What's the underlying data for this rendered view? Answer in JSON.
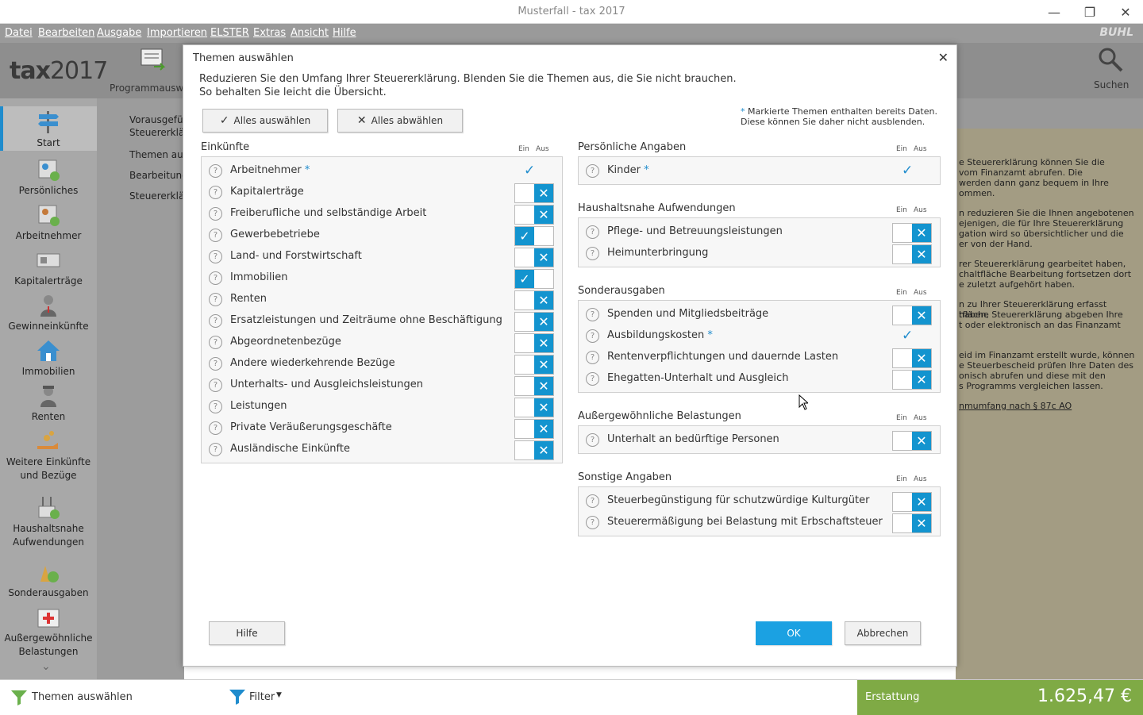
{
  "window": {
    "title": "Musterfall - tax 2017",
    "minimize": "—",
    "restore": "❐",
    "close": "✕"
  },
  "menu": {
    "items": [
      "Datei",
      "Bearbeiten",
      "Ausgabe",
      "Importieren",
      "ELSTER",
      "Extras",
      "Ansicht",
      "Hilfe"
    ],
    "brand": "BUHL"
  },
  "ribbon": {
    "logo_tax": "tax",
    "logo_year": "2017",
    "program_button": "Programmausw",
    "search_button": "Suchen"
  },
  "sidebar": {
    "items": [
      {
        "label": "Start",
        "icon": "signpost-icon"
      },
      {
        "label": "Persönliches",
        "icon": "person-card-icon"
      },
      {
        "label": "Arbeitnehmer",
        "icon": "worker-icon"
      },
      {
        "label": "Kapitalerträge",
        "icon": "money-icon"
      },
      {
        "label": "Gewinneinkünfte",
        "icon": "businessman-icon"
      },
      {
        "label": "Immobilien",
        "icon": "house-icon"
      },
      {
        "label": "Renten",
        "icon": "pensioner-icon"
      },
      {
        "label": "Weitere Einkünfte und Bezüge",
        "icon": "coins-hand-icon"
      },
      {
        "label": "Haushaltsnahe Aufwendungen",
        "icon": "household-icon"
      },
      {
        "label": "Sonderausgaben",
        "icon": "special-expenses-icon"
      },
      {
        "label": "Außergewöhnliche Belastungen",
        "icon": "first-aid-icon"
      }
    ]
  },
  "left_panel": {
    "items": [
      "Vorausgefü",
      "Steuererklä",
      "Themen aus",
      "Bearbeitung",
      "Steuererklä"
    ]
  },
  "right_panel": {
    "lines": [
      "e Steuererklärung können Sie die",
      "vom Finanzamt abrufen. Die",
      "werden dann ganz bequem in Ihre",
      "ommen.",
      "n reduzieren Sie die Ihnen angebotenen",
      "ejenigen, die für Ihre Steuererklärung",
      "gation wird so übersichtlicher und die",
      "er von der Hand.",
      "rer Steuererklärung gearbeitet haben,",
      "chaltfläche Bearbeitung fortsetzen dort",
      "e zuletzt aufgehört haben.",
      "n zu Ihrer Steuererklärung erfasst haben,",
      "tfläche Steuererklärung abgeben Ihre",
      "t oder elektronisch an das Finanzamt",
      "eid im Finanzamt erstellt wurde, können",
      "e Steuerbescheid prüfen Ihre Daten des",
      "onisch abrufen und diese mit den",
      "s Programms vergleichen lassen.",
      "nmumfang nach § 87c AO"
    ]
  },
  "bottom": {
    "themen": "Themen auswählen",
    "filter": "Filter",
    "erstattung_label": "Erstattung",
    "erstattung_value": "1.625,47 €"
  },
  "dialog": {
    "title": "Themen auswählen",
    "close": "✕",
    "intro1": "Reduzieren Sie den Umfang Ihrer Steuererklärung. Blenden Sie die Themen aus, die Sie nicht brauchen.",
    "intro2": "So behalten Sie leicht die Übersicht.",
    "note_star": "*",
    "note1": " Markierte Themen enthalten bereits Daten.",
    "note2": "Diese können Sie daher nicht ausblenden.",
    "select_all": "Alles auswählen",
    "deselect_all": "Alles abwählen",
    "ein": "Ein",
    "aus": "Aus",
    "help_button": "Hilfe",
    "ok_button": "OK",
    "cancel_button": "Abbrechen",
    "sections_left": [
      {
        "title": "Einkünfte",
        "rows": [
          {
            "label": "Arbeitnehmer",
            "star": true,
            "state": "locked"
          },
          {
            "label": "Kapitalerträge",
            "state": "aus"
          },
          {
            "label": "Freiberufliche und selbständige Arbeit",
            "state": "aus"
          },
          {
            "label": "Gewerbebetriebe",
            "state": "ein"
          },
          {
            "label": "Land- und Forstwirtschaft",
            "state": "aus"
          },
          {
            "label": "Immobilien",
            "state": "ein"
          },
          {
            "label": "Renten",
            "state": "aus"
          },
          {
            "label": "Ersatzleistungen und Zeiträume ohne Beschäftigung",
            "state": "aus"
          },
          {
            "label": "Abgeordnetenbezüge",
            "state": "aus"
          },
          {
            "label": "Andere wiederkehrende Bezüge",
            "state": "aus"
          },
          {
            "label": "Unterhalts- und Ausgleichsleistungen",
            "state": "aus"
          },
          {
            "label": "Leistungen",
            "state": "aus"
          },
          {
            "label": "Private Veräußerungsgeschäfte",
            "state": "aus"
          },
          {
            "label": "Ausländische Einkünfte",
            "state": "aus"
          }
        ]
      }
    ],
    "sections_right": [
      {
        "title": "Persönliche Angaben",
        "rows": [
          {
            "label": "Kinder",
            "star": true,
            "state": "locked"
          }
        ]
      },
      {
        "title": "Haushaltsnahe Aufwendungen",
        "rows": [
          {
            "label": "Pflege- und Betreuungsleistungen",
            "state": "aus"
          },
          {
            "label": "Heimunterbringung",
            "state": "aus"
          }
        ]
      },
      {
        "title": "Sonderausgaben",
        "rows": [
          {
            "label": "Spenden und Mitgliedsbeiträge",
            "state": "aus"
          },
          {
            "label": "Ausbildungskosten",
            "star": true,
            "state": "locked"
          },
          {
            "label": "Rentenverpflichtungen und dauernde Lasten",
            "state": "aus"
          },
          {
            "label": "Ehegatten-Unterhalt und Ausgleich",
            "state": "aus"
          }
        ]
      },
      {
        "title": "Außergewöhnliche Belastungen",
        "rows": [
          {
            "label": "Unterhalt an bedürftige Personen",
            "state": "aus"
          }
        ]
      },
      {
        "title": "Sonstige Angaben",
        "rows": [
          {
            "label": "Steuerbegünstigung für schutzwürdige Kulturgüter",
            "state": "aus"
          },
          {
            "label": "Steuerermäßigung bei Belastung mit Erbschaftsteuer",
            "state": "aus"
          }
        ]
      }
    ]
  },
  "colors": {
    "accent": "#1394cf",
    "erstattung": "#7faa45",
    "sidebar": "#a8a8a8"
  }
}
